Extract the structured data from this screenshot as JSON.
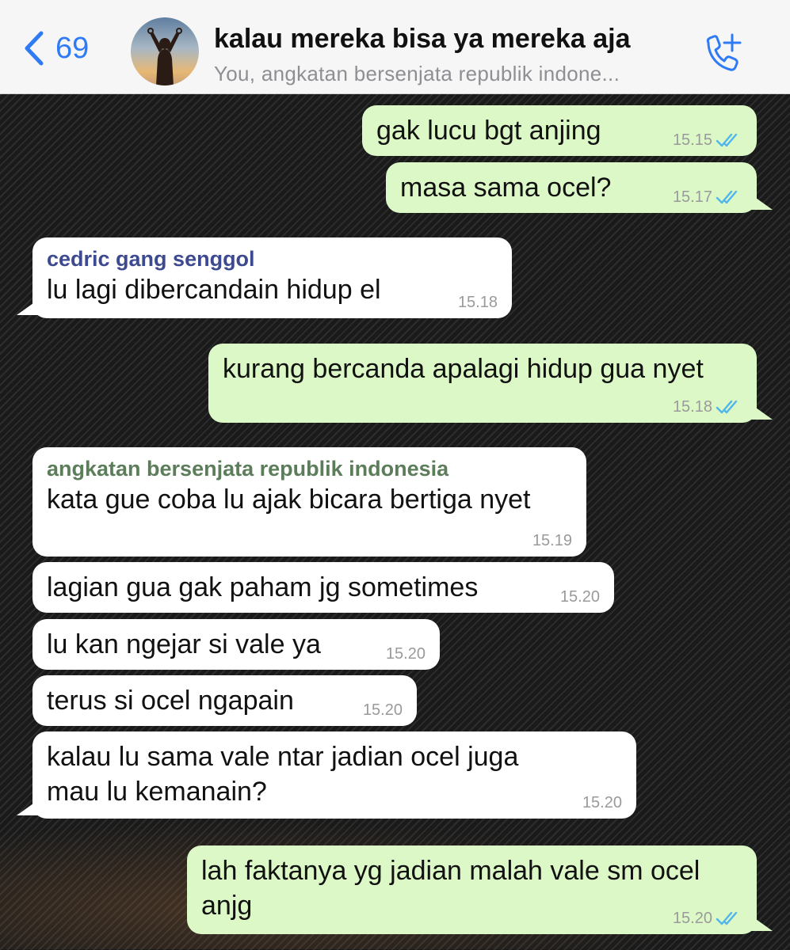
{
  "header": {
    "back_count": "69",
    "chat_title": "kalau mereka bisa ya mereka aja",
    "participants": "You, angkatan bersenjata republik indone..."
  },
  "colors": {
    "accent": "#2f7bf6",
    "outgoing_bubble": "#dcf8c6",
    "incoming_bubble": "#ffffff",
    "read_ticks": "#4fb6ec"
  },
  "icons": {
    "back": "chevron-left-icon",
    "call": "phone-plus-icon",
    "read": "double-check-icon"
  },
  "messages": [
    {
      "dir": "out",
      "text": "gak lucu bgt anjing",
      "time": "15.15"
    },
    {
      "dir": "out",
      "text": "masa sama ocel?",
      "time": "15.17"
    },
    {
      "dir": "in",
      "sender": "cedric gang senggol",
      "text": "lu lagi dibercandain hidup el",
      "time": "15.18"
    },
    {
      "dir": "out",
      "text": "kurang bercanda apalagi hidup gua nyet",
      "time": "15.18"
    },
    {
      "dir": "in",
      "sender": "angkatan bersenjata republik indonesia",
      "text": "kata gue coba lu ajak bicara bertiga nyet",
      "time": "15.19"
    },
    {
      "dir": "in",
      "text": "lagian gua gak paham jg sometimes",
      "time": "15.20"
    },
    {
      "dir": "in",
      "text": "lu kan ngejar si vale ya",
      "time": "15.20"
    },
    {
      "dir": "in",
      "text": "terus si ocel ngapain",
      "time": "15.20"
    },
    {
      "dir": "in",
      "text": "kalau lu sama vale ntar jadian ocel juga mau lu kemanain?",
      "time": "15.20"
    },
    {
      "dir": "out",
      "text": "lah faktanya yg jadian malah vale sm ocel anjg",
      "time": "15.20"
    }
  ]
}
